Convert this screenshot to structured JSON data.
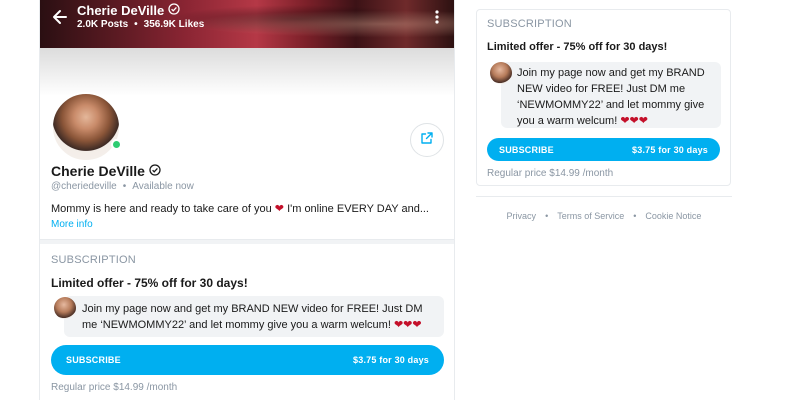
{
  "header": {
    "name": "Cherie DeVille",
    "posts": "2.0K Posts",
    "likes": "356.9K Likes"
  },
  "profile": {
    "name": "Cherie DeVille",
    "handle": "@cheriedeville",
    "status": "Available now",
    "bio_part1": "Mommy is here and ready to take care of you",
    "bio_part2": "I'm online EVERY DAY and...",
    "more_info": "More info",
    "online": true
  },
  "subscription_main": {
    "label": "SUBSCRIPTION",
    "offer": "Limited offer - 75% off for 30 days!",
    "message": "Join my page now and get my BRAND NEW video for FREE! Just DM me ‘NEWMOMMY22’ and let mommy give you a warm welcum!",
    "hearts": "❤❤❤",
    "subscribe_label": "SUBSCRIBE",
    "price_label": "$3.75 for 30 days",
    "regular_price": "Regular price $14.99 /month"
  },
  "subscription_side": {
    "label": "SUBSCRIPTION",
    "offer": "Limited offer - 75% off for 30 days!",
    "message": "Join my page now and get my BRAND NEW video for FREE! Just DM me ‘NEWMOMMY22’ and let mommy give you a warm welcum!",
    "hearts": "❤❤❤",
    "subscribe_label": "SUBSCRIBE",
    "price_label": "$3.75 for 30 days",
    "regular_price": "Regular price $14.99 /month"
  },
  "footer": {
    "privacy": "Privacy",
    "terms": "Terms of Service",
    "cookie": "Cookie Notice",
    "separator": "•"
  },
  "icons": {
    "heart": "❤",
    "verified": "verified-icon",
    "back": "back-arrow-icon",
    "more": "more-vertical-icon",
    "share": "share-icon"
  },
  "colors": {
    "accent": "#00aff0",
    "muted": "#8a96a3",
    "online": "#2ecc71",
    "heart": "#c4102a"
  }
}
